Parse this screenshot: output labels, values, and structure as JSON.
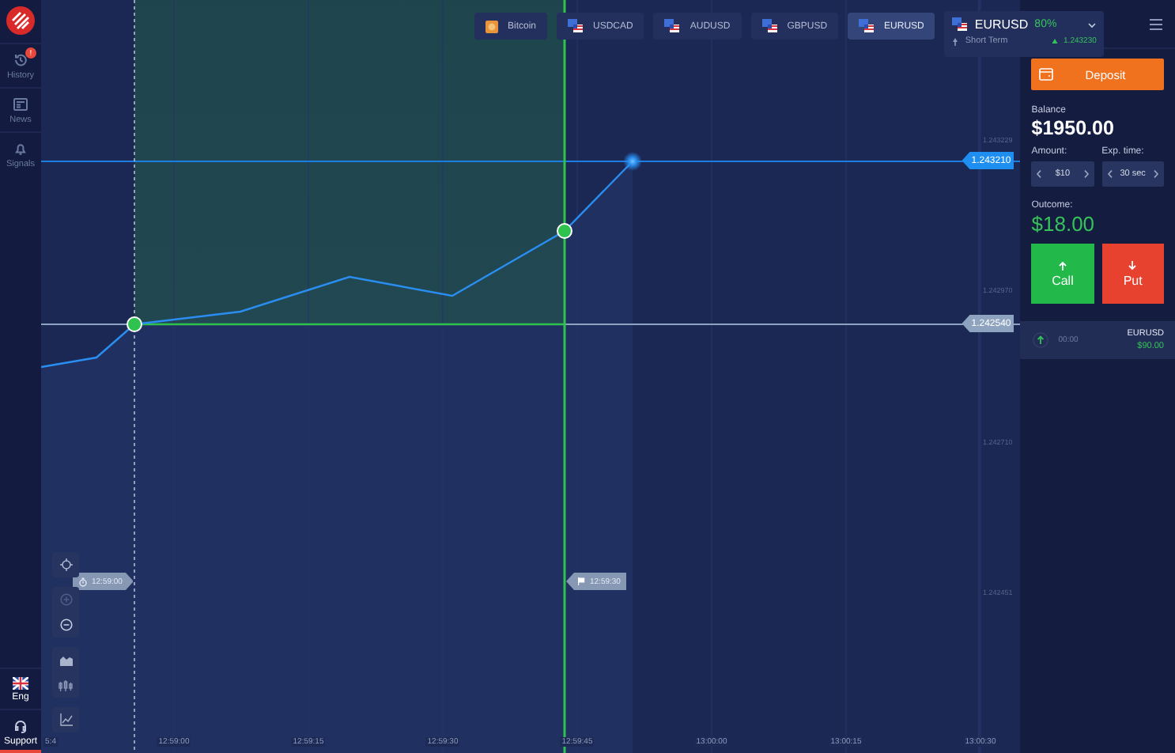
{
  "sidebar": {
    "items": [
      {
        "label": "History",
        "kind": "history",
        "badge": "!"
      },
      {
        "label": "News",
        "kind": "news"
      },
      {
        "label": "Signals",
        "kind": "signals"
      }
    ],
    "language": "Eng",
    "support": {
      "label": "Support",
      "selected": true
    }
  },
  "asset_tabs": [
    {
      "label": "Bitcoin",
      "kind": "coin",
      "selected": false
    },
    {
      "label": "USDCAD",
      "kind": "flag",
      "selected": false
    },
    {
      "label": "AUDUSD",
      "kind": "flag",
      "selected": false
    },
    {
      "label": "GBPUSD",
      "kind": "flag",
      "selected": false
    },
    {
      "label": "EURUSD",
      "kind": "flag",
      "selected": true
    }
  ],
  "asset_selector": {
    "name": "EURUSD",
    "payout": "80%",
    "mode": "Short Term",
    "price": "1.243230"
  },
  "chart": {
    "price_tags": [
      {
        "label": "1.243210",
        "kind": "current"
      },
      {
        "label": "1.242540",
        "kind": "open"
      }
    ],
    "y_ticks": [
      "1.243229",
      "1.242970",
      "1.242710",
      "1.242451"
    ],
    "x_ticks": [
      "5:4",
      "12:59:00",
      "12:59:15",
      "12:59:30",
      "12:59:45",
      "13:00:00",
      "13:00:15",
      "13:00:30"
    ],
    "start_time": "12:59:00",
    "end_time": "12:59:30"
  },
  "trade_panel": {
    "deposit": "Deposit",
    "balance_label": "Balance",
    "balance": "$1950.00",
    "amount_label": "Amount:",
    "amount": "$10",
    "exp_label": "Exp. time:",
    "exp": "30 sec",
    "outcome_label": "Outcome:",
    "outcome": "$18.00",
    "call": "Call",
    "put": "Put"
  },
  "open_trades": [
    {
      "asset": "EURUSD",
      "time": "00:00",
      "amount": "$90.00"
    }
  ]
}
